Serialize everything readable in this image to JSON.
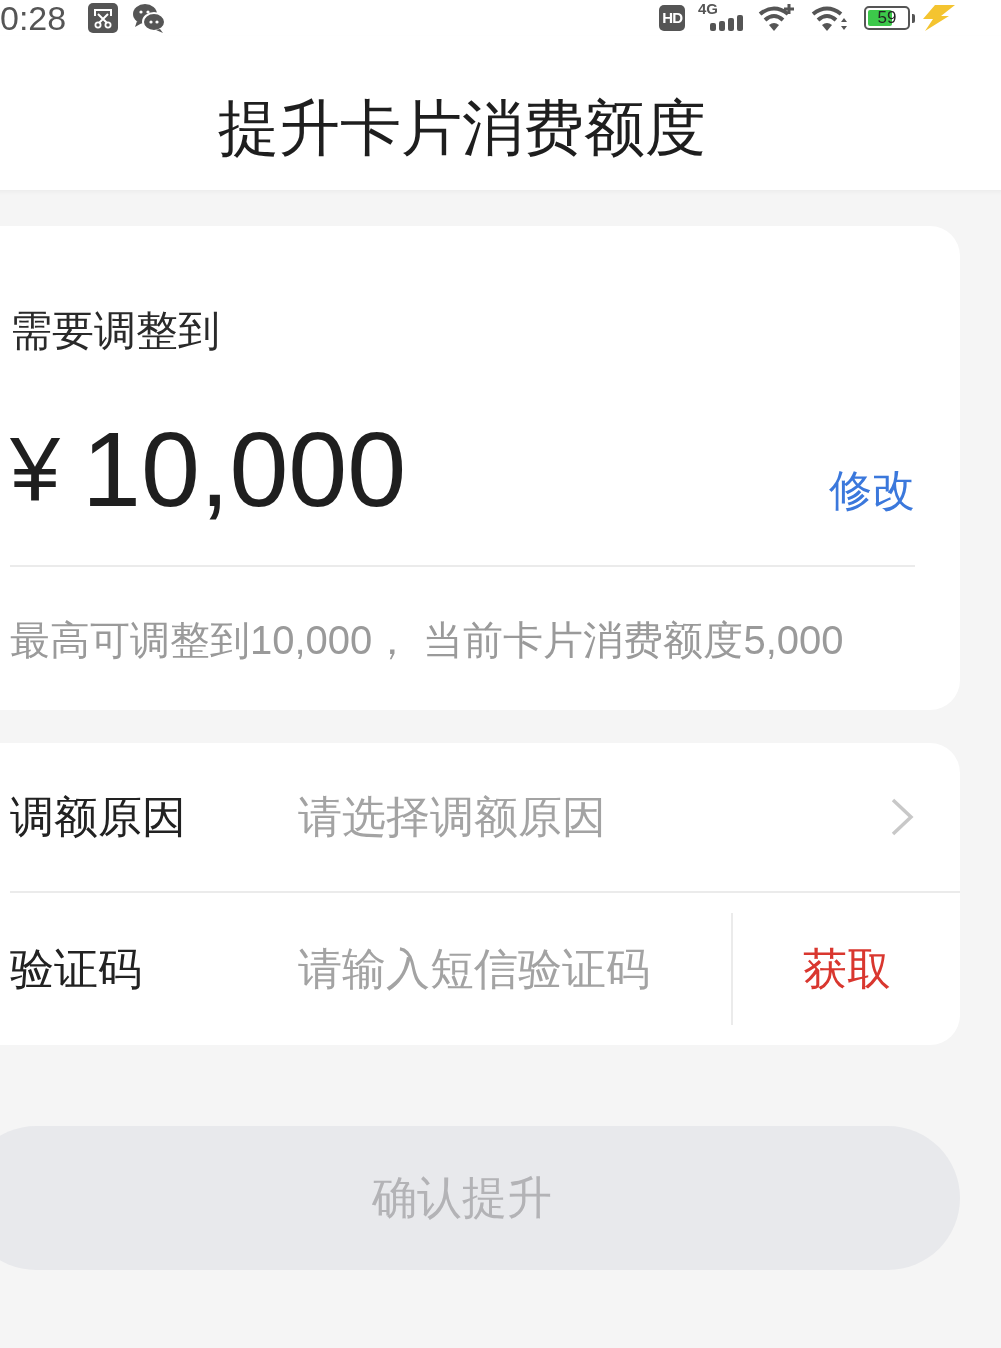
{
  "status_bar": {
    "time": "0:28",
    "hd": "HD",
    "network": "4G",
    "battery": "59"
  },
  "header": {
    "title": "提升卡片消费额度"
  },
  "amount_card": {
    "label": "需要调整到",
    "currency": "¥",
    "amount": "10,000",
    "edit_link": "修改",
    "hint": "最高可调整到10,000， 当前卡片消费额度5,000"
  },
  "form": [
    {
      "kind": "select",
      "label": "调额原因",
      "placeholder": "请选择调额原因"
    },
    {
      "kind": "code",
      "label": "验证码",
      "placeholder": "请输入短信验证码",
      "action": "获取"
    }
  ],
  "confirm_button": {
    "label": "确认提升",
    "disabled": true
  }
}
